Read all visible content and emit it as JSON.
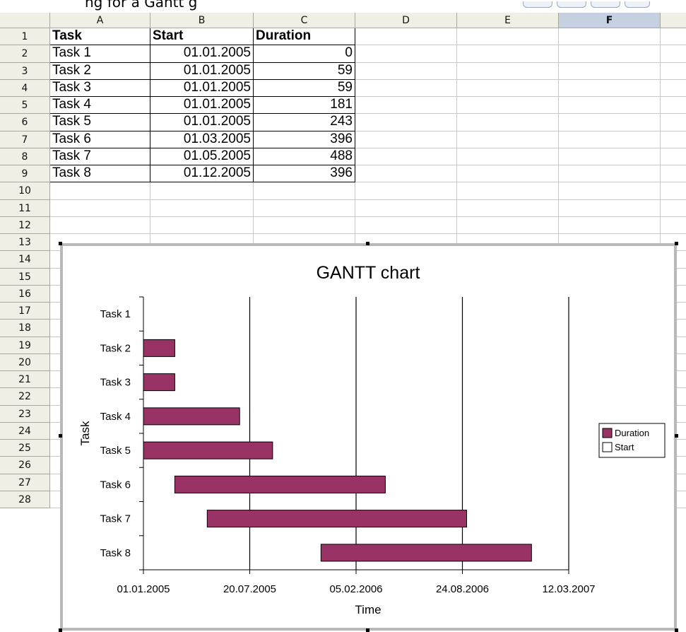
{
  "columns": [
    "A",
    "B",
    "C",
    "D",
    "E",
    "F"
  ],
  "selected_column": "F",
  "row_numbers": [
    "1",
    "2",
    "3",
    "4",
    "5",
    "6",
    "7",
    "8",
    "9",
    "10",
    "11",
    "12",
    "13",
    "14",
    "15",
    "16",
    "17",
    "18",
    "19",
    "20",
    "21",
    "22",
    "23",
    "24",
    "25",
    "26",
    "27",
    "28"
  ],
  "table": {
    "headers": [
      "Task",
      "Start",
      "Duration"
    ],
    "rows": [
      [
        "Task 1",
        "01.01.2005",
        "0"
      ],
      [
        "Task 2",
        "01.01.2005",
        "59"
      ],
      [
        "Task 3",
        "01.01.2005",
        "59"
      ],
      [
        "Task 4",
        "01.01.2005",
        "181"
      ],
      [
        "Task 5",
        "01.01.2005",
        "243"
      ],
      [
        "Task 6",
        "01.03.2005",
        "396"
      ],
      [
        "Task 7",
        "01.05.2005",
        "488"
      ],
      [
        "Task 8",
        "01.12.2005",
        "396"
      ]
    ]
  },
  "chart_data": {
    "type": "bar",
    "orientation": "horizontal-stacked",
    "title": "GANTT chart",
    "xlabel": "Time",
    "ylabel": "Task",
    "categories": [
      "Task 1",
      "Task 2",
      "Task 3",
      "Task 4",
      "Task 5",
      "Task 6",
      "Task 7",
      "Task 8"
    ],
    "series": [
      {
        "name": "Start",
        "values": [
          "01.01.2005",
          "01.01.2005",
          "01.01.2005",
          "01.01.2005",
          "01.01.2005",
          "01.03.2005",
          "01.05.2005",
          "01.12.2005"
        ],
        "color": "#ffffff",
        "visible": false
      },
      {
        "name": "Duration",
        "values": [
          0,
          59,
          59,
          181,
          243,
          396,
          488,
          396
        ],
        "color": "#993366"
      }
    ],
    "x_ticks": [
      "01.01.2005",
      "20.07.2005",
      "05.02.2006",
      "24.08.2006",
      "12.03.2007"
    ],
    "xlim": [
      "01.01.2005",
      "12.03.2007"
    ],
    "grid": "vertical major lines",
    "legend_position": "right"
  }
}
